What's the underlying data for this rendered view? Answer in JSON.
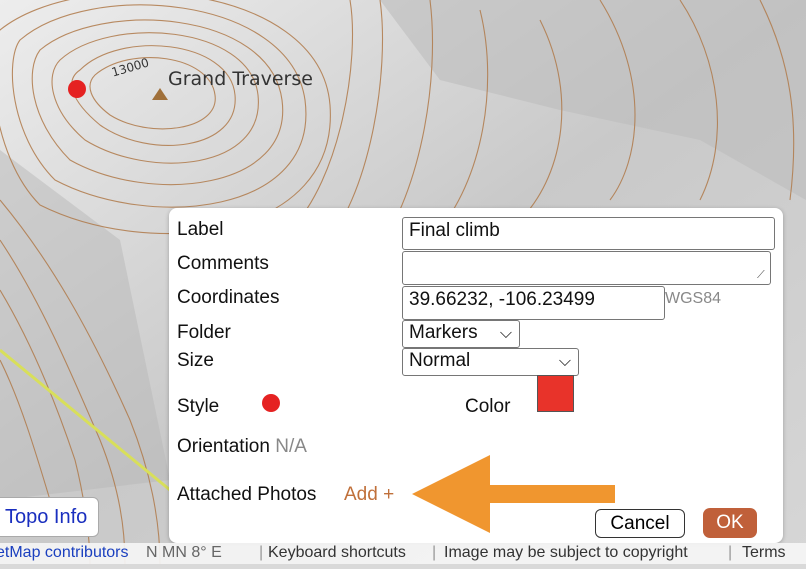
{
  "map": {
    "peak_name": "Grand Traverse",
    "contour_label": "13000"
  },
  "dialog": {
    "label": {
      "title": "Label",
      "value": "Final climb"
    },
    "comments": {
      "title": "Comments",
      "value": ""
    },
    "coordinates": {
      "title": "Coordinates",
      "value": "39.66232, -106.23499",
      "datum": "WGS84"
    },
    "folder": {
      "title": "Folder",
      "value": "Markers"
    },
    "size": {
      "title": "Size",
      "value": "Normal"
    },
    "style": {
      "title": "Style"
    },
    "color": {
      "title": "Color",
      "hex": "#e8332a"
    },
    "orientation": {
      "title": "Orientation",
      "value": "N/A"
    },
    "attached_photos": {
      "title": "Attached Photos",
      "add_label": "Add +"
    },
    "cancel_label": "Cancel",
    "ok_label": "OK"
  },
  "topo_info_label": "Topo Info",
  "footer": {
    "attribution": "etMap contributors",
    "declination": "N MN 8° E",
    "keyboard_shortcuts": "Keyboard shortcuts",
    "copyright": "Image may be subject to copyright",
    "terms": "Terms"
  },
  "colors": {
    "accent": "#c0603a",
    "marker": "#e52222",
    "annotation_arrow": "#f0962f"
  }
}
